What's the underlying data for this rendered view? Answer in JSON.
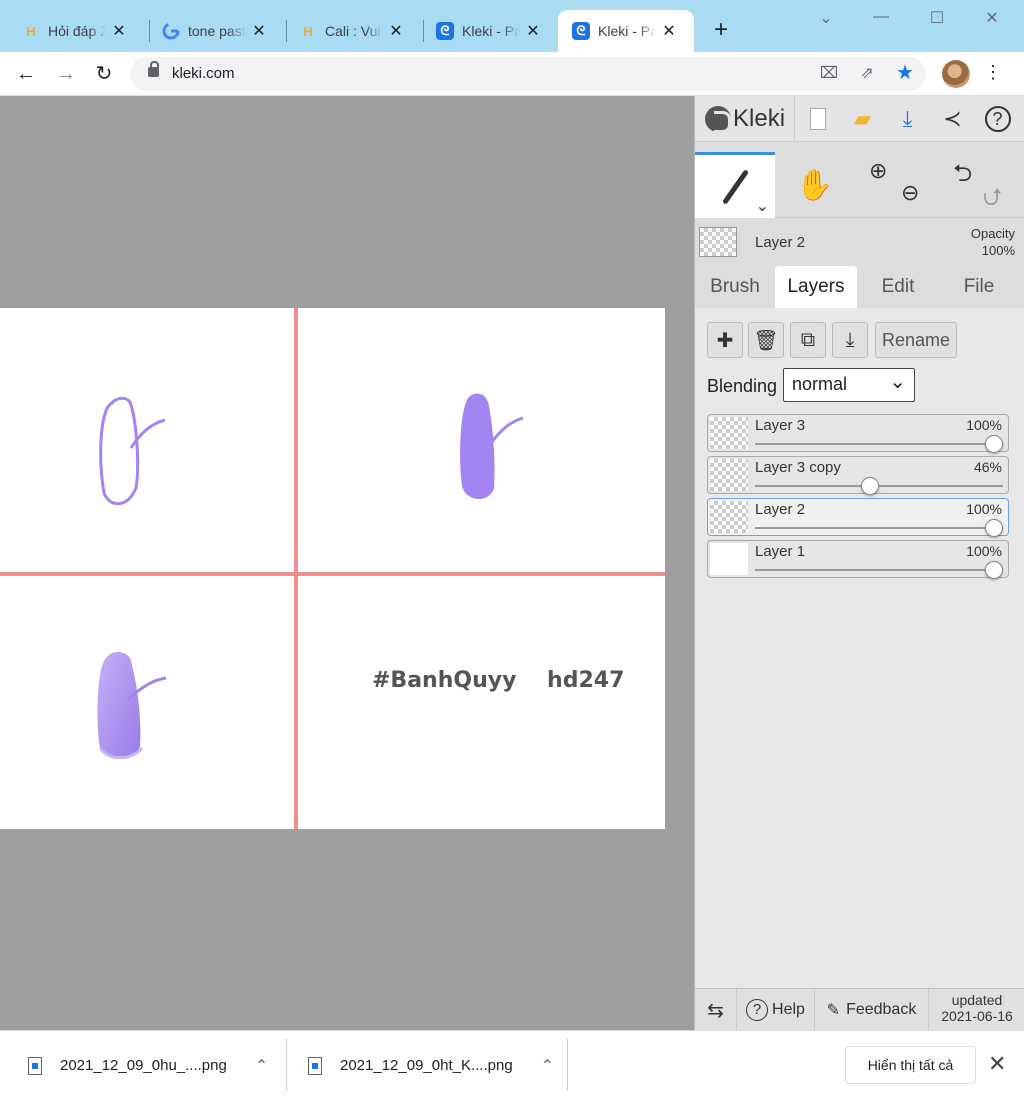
{
  "browser": {
    "tabs": [
      {
        "title": "Hỏi đáp Z",
        "favicon": "hoidap-h-icon",
        "active": false
      },
      {
        "title": "tone past",
        "favicon": "google-g-icon",
        "active": false
      },
      {
        "title": "Cali : Vui",
        "favicon": "hoidap-h-icon",
        "active": false
      },
      {
        "title": "Kleki - Pa",
        "favicon": "kleki-icon",
        "active": false
      },
      {
        "title": "Kleki - Pa",
        "favicon": "kleki-icon",
        "active": true
      }
    ],
    "new_tab": "+",
    "url": "kleki.com"
  },
  "canvas": {
    "watermark": "#BanhQuyy    hd247",
    "colors": {
      "background": "#9e9e9e",
      "guide": "#ef8f8f",
      "stroke": "#a384f0"
    }
  },
  "panel": {
    "logo": "Kleki",
    "current_layer": {
      "name": "Layer 2",
      "opacity_label": "Opacity",
      "opacity_value": "100%"
    },
    "tabs": [
      "Brush",
      "Layers",
      "Edit",
      "File"
    ],
    "active_tab": "Layers",
    "rename_label": "Rename",
    "blending_label": "Blending",
    "blending_value": "normal",
    "layers": [
      {
        "name": "Layer 3",
        "opacity": "100%",
        "value": 1.0,
        "selected": false
      },
      {
        "name": "Layer 3 copy",
        "opacity": "46%",
        "value": 0.46,
        "selected": false
      },
      {
        "name": "Layer 2",
        "opacity": "100%",
        "value": 1.0,
        "selected": true
      },
      {
        "name": "Layer 1",
        "opacity": "100%",
        "value": 1.0,
        "selected": false
      }
    ],
    "bottom": {
      "help": "Help",
      "feedback": "Feedback",
      "updated_label": "updated",
      "updated_date": "2021-06-16"
    }
  },
  "downloads": {
    "items": [
      "2021_12_09_0hu_....png",
      "2021_12_09_0ht_K....png"
    ],
    "show_all": "Hiển thị tất cả"
  }
}
